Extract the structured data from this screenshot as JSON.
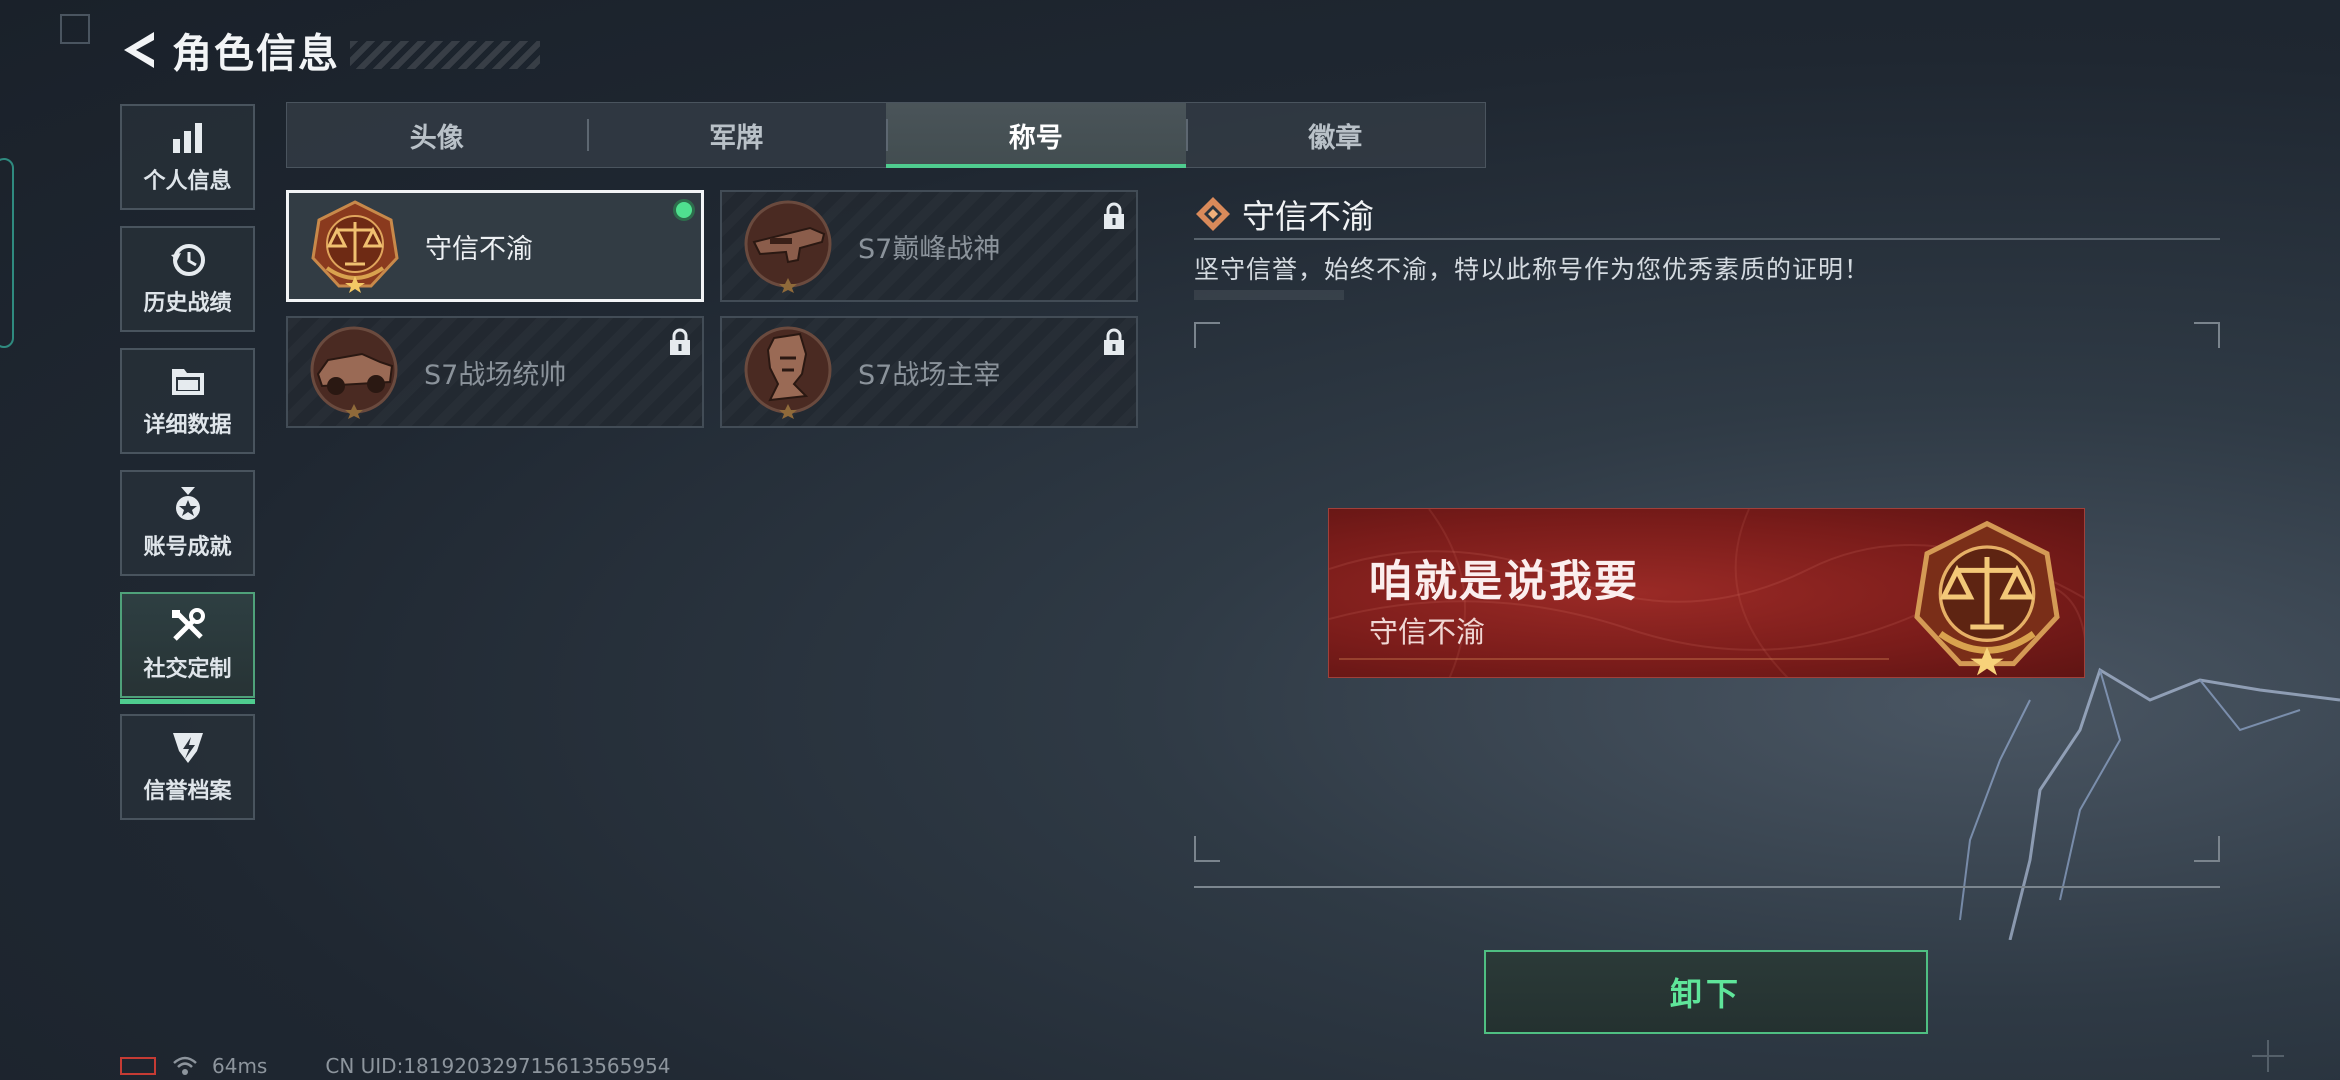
{
  "header": {
    "title": "角色信息",
    "back_icon": "back-arrow-icon"
  },
  "sidebar": {
    "items": [
      {
        "label": "个人信息",
        "icon": "bar-chart-icon"
      },
      {
        "label": "历史战绩",
        "icon": "history-clock-icon"
      },
      {
        "label": "详细数据",
        "icon": "folder-icon"
      },
      {
        "label": "账号成就",
        "icon": "medal-icon"
      },
      {
        "label": "社交定制",
        "icon": "tools-icon",
        "active": true
      },
      {
        "label": "信誉档案",
        "icon": "credit-shield-icon"
      }
    ]
  },
  "tabs": [
    {
      "label": "头像"
    },
    {
      "label": "军牌"
    },
    {
      "label": "称号",
      "active": true
    },
    {
      "label": "徽章"
    }
  ],
  "titles": [
    {
      "name": "守信不渝",
      "emblem": "scales-emblem-icon",
      "selected": true,
      "equipped": true,
      "locked": false
    },
    {
      "name": "S7巅峰战神",
      "emblem": "rifle-emblem-icon",
      "selected": false,
      "equipped": false,
      "locked": true
    },
    {
      "name": "S7战场统帅",
      "emblem": "vehicle-emblem-icon",
      "selected": false,
      "equipped": false,
      "locked": true
    },
    {
      "name": "S7战场主宰",
      "emblem": "soldier-emblem-icon",
      "selected": false,
      "equipped": false,
      "locked": true
    }
  ],
  "detail": {
    "title": "守信不渝",
    "description": "坚守信誉，始终不渝，特以此称号作为您优秀素质的证明！"
  },
  "preview": {
    "main_text": "咱就是说我要",
    "sub_text": "守信不渝"
  },
  "actions": {
    "unequip_label": "卸下"
  },
  "status": {
    "ping": "64ms",
    "uid": "CN UID:181920329715613565954"
  },
  "colors": {
    "accent_green": "#4fcc8f",
    "banner_red": "#8a2220",
    "background": "#1f2731"
  }
}
